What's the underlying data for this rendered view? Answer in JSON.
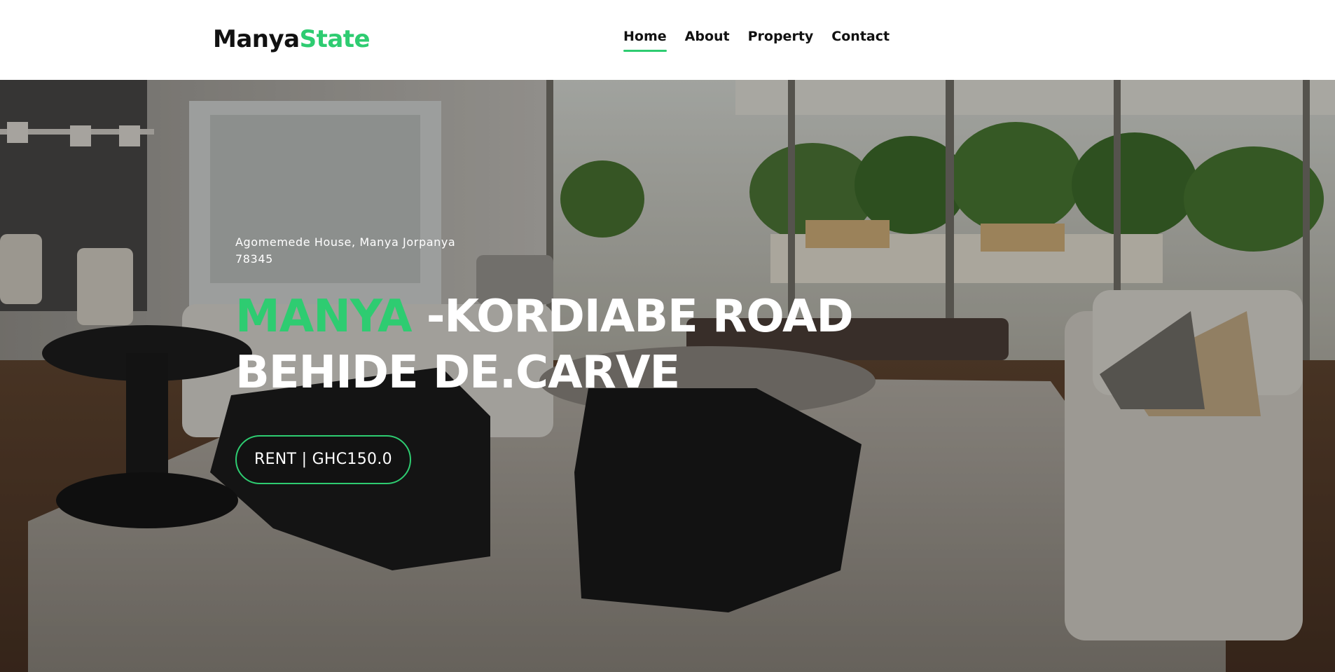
{
  "brand": {
    "part1": "Manya",
    "part2": "State"
  },
  "nav": {
    "items": [
      {
        "label": "Home",
        "active": true
      },
      {
        "label": "About",
        "active": false
      },
      {
        "label": "Property",
        "active": false
      },
      {
        "label": "Contact",
        "active": false
      }
    ]
  },
  "hero": {
    "address": "Agomemede House, Manya Jorpanya 78345",
    "title_accent": "MANYA",
    "title_rest": " -KORDIABE ROAD BEHIDE DE.CARVE",
    "price_button": "RENT | GHC150.0"
  },
  "colors": {
    "accent": "#2ecc71",
    "text_dark": "#111111",
    "hero_text": "#ffffff"
  }
}
